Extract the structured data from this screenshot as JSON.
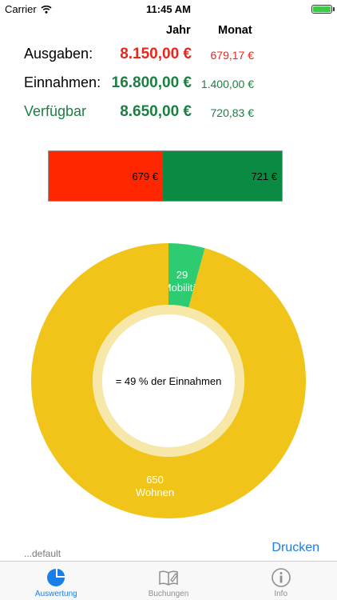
{
  "status_bar": {
    "carrier": "Carrier",
    "time": "11:45 AM"
  },
  "columns": {
    "year": "Jahr",
    "month": "Monat"
  },
  "rows": [
    {
      "label": "Ausgaben:",
      "year": "8.150,00 €",
      "month": "679,17 €"
    },
    {
      "label": "Einnahmen:",
      "year": "16.800,00 €",
      "month": "1.400,00 €"
    },
    {
      "label": "Verfügbar",
      "year": "8.650,00 €",
      "month": "720,83 €"
    }
  ],
  "split_bar": {
    "left_label": "679 €",
    "right_label": "721 €"
  },
  "chart_data": {
    "type": "pie",
    "categories": [
      "Mobilität",
      "Wohnen"
    ],
    "values": [
      29,
      650
    ],
    "center_text": "= 49 % der Einnahmen"
  },
  "colors": {
    "segment_0": "#2ecc71",
    "segment_1": "#f0c419",
    "expense_red": "#ff2600",
    "income_green": "#0a8a43",
    "accent_blue": "#1a7ee8"
  },
  "footer": {
    "note": "...default",
    "print_label": "Drucken"
  },
  "tabs": [
    {
      "label": "Auswertung",
      "icon": "pie-chart-icon",
      "active": true
    },
    {
      "label": "Buchungen",
      "icon": "book-edit-icon",
      "active": false
    },
    {
      "label": "Info",
      "icon": "info-icon",
      "active": false
    }
  ]
}
